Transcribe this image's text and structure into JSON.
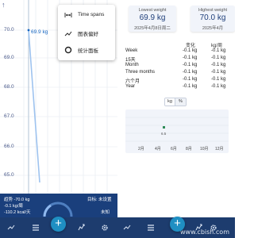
{
  "left": {
    "chart": {
      "y_labels": [
        "70.0",
        "69.0",
        "68.0",
        "67.0",
        "66.0",
        "65.0"
      ],
      "point_label": "69.9 kg"
    },
    "menu": {
      "items": [
        {
          "label": "Time spans",
          "icon": "time-span-icon"
        },
        {
          "label": "图表偏好",
          "icon": "chart-line-icon"
        },
        {
          "label": "统计面板",
          "icon": "stats-ring-icon"
        }
      ]
    },
    "summary": {
      "trend": "趋势 -70.0 kg",
      "rate": "-0.1 kg/周",
      "calories": "-110.2 kcal/天",
      "goal": "目标: 未设置",
      "unknown": "未知"
    }
  },
  "right": {
    "lowest": {
      "title": "Lowest weight",
      "value": "69.9 kg",
      "date": "2025年4月8日周二"
    },
    "highest": {
      "title": "Highest weight",
      "value": "70.0 kg",
      "date": "2025年4月"
    },
    "table": {
      "headers": [
        "变化",
        "kg/周"
      ],
      "rows": [
        {
          "label": "Week",
          "change": "-0.1 kg",
          "rate": "-0.1 kg"
        },
        {
          "label": "15天",
          "change": "-0.1 kg",
          "rate": "-0.1 kg"
        },
        {
          "label": "Month",
          "change": "-0.1 kg",
          "rate": "-0.1 kg"
        },
        {
          "label": "Three months",
          "change": "-0.1 kg",
          "rate": "-0.1 kg"
        },
        {
          "label": "六个月",
          "change": "-0.1 kg",
          "rate": "-0.1 kg"
        },
        {
          "label": "Year",
          "change": "-0.1 kg",
          "rate": "-0.1 kg"
        }
      ]
    },
    "unit_toggle": {
      "kg": "kg",
      "percent": "%"
    },
    "mini_chart": {
      "x_labels": [
        "2月",
        "4月",
        "6月",
        "8月",
        "10月",
        "12月"
      ],
      "point_value": "6.5"
    }
  },
  "watermark": "www.cbish.com",
  "colors": {
    "accent": "#1f8fc3",
    "navbar": "#1d3c6e",
    "summary": "#1a3f7c",
    "card": "#f1f4fa",
    "point": "#2e8b57"
  }
}
